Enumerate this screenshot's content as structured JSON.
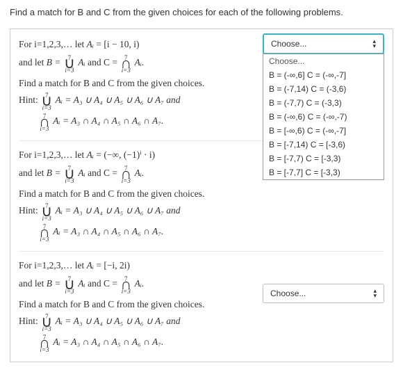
{
  "header": "Find a match for B and C from the given choices for each of the following problems.",
  "problems": [
    {
      "forLine": "For i=1,2,3,…   let ",
      "A_def": " = [i − 10, i)",
      "andLet": "and let ",
      "B_label": "B = ",
      "C_label": " and  C = ",
      "matchLine": "Find a match for B and C from the given choices.",
      "hintLabel": "Hint: ",
      "hint_union": " = A₃ ∪ A₄ ∪ A₅ ∪ A₆ ∪ A₇  and",
      "hint_inter": " = A₃ ∩ A₄ ∩ A₅ ∩ A₆ ∩ A₇."
    },
    {
      "forLine": "For i=1,2,3,…   let ",
      "A_def": " = (−∞, (−1)ⁱ · i)",
      "andLet": "and let ",
      "B_label": "B = ",
      "C_label": " and  C = ",
      "matchLine": "Find a match for B and C from the given choices.",
      "hintLabel": "Hint: ",
      "hint_union": " = A₃ ∪ A₄ ∪ A₅ ∪ A₆ ∪ A₇  and",
      "hint_inter": " = A₃ ∩ A₄ ∩ A₅ ∩ A₆ ∩ A₇."
    },
    {
      "forLine": "For i=1,2,3,…   let ",
      "A_def": " = [−i, 2i)",
      "andLet": "and let ",
      "B_label": "B = ",
      "C_label": " and  C = ",
      "matchLine": "Find a match for B and C from the given choices.",
      "hintLabel": "Hint: ",
      "hint_union": " = A₃ ∪ A₄ ∪ A₅ ∪ A₆ ∪ A₇  and",
      "hint_inter": " = A₃ ∩ A₄ ∩ A₅ ∩ A₆ ∩ A₇."
    }
  ],
  "op": {
    "top": "7",
    "bot": "i=3",
    "union": "∪",
    "inter": "∩",
    "arg": "Aᵢ",
    "argDot": "Aᵢ."
  },
  "A_i": "Aᵢ",
  "dropdown": {
    "placeholder": "Choose...",
    "options": [
      "Choose...",
      "B = (-∞,6] C = (-∞,-7]",
      "B = (-7,14) C = (-3,6)",
      "B = (-7,7) C = (-3,3)",
      "B = (-∞,6) C = (-∞,-7)",
      "B = [-∞,6) C = (-∞,-7]",
      "B = [-7,14) C = [-3,6)",
      "B = [-7,7) C = [-3,3)",
      "B = [-7,7] C = [-3,3)"
    ]
  }
}
